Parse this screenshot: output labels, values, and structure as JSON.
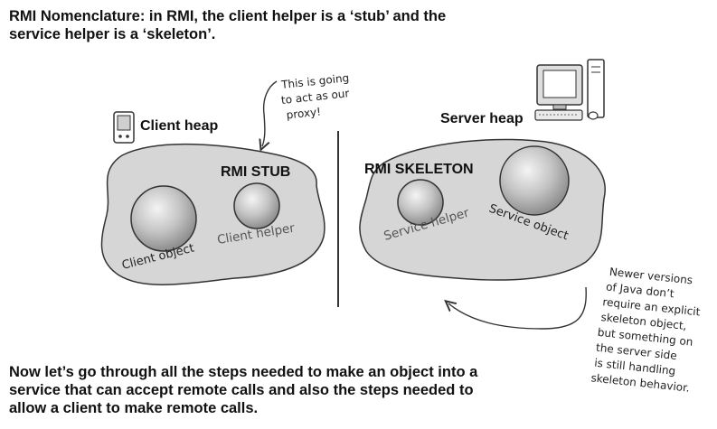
{
  "heading": {
    "line1": "RMI Nomenclature: in RMI, the client helper is a ‘stub’ and the",
    "line2": "service helper is a ‘skeleton’."
  },
  "client_side": {
    "heap_label": "Client heap",
    "stub_label": "RMI STUB",
    "object_label": "Client object",
    "helper_label": "Client helper"
  },
  "server_side": {
    "heap_label": "Server heap",
    "skeleton_label": "RMI SKELETON",
    "helper_label": "Service helper",
    "object_label": "Service object"
  },
  "proxy_note": {
    "lines": [
      "This is going",
      "to act as our",
      "proxy!"
    ]
  },
  "skeleton_note": {
    "lines": [
      "Newer versions",
      "of Java don’t",
      "require an explicit",
      "skeleton object,",
      "but something on",
      "the server side",
      "is still handling",
      "skeleton behavior."
    ]
  },
  "footer": {
    "line1": "Now let’s go through all the steps needed to make an object into a",
    "line2": "service that can accept remote calls and also the steps needed to",
    "line3": "allow a client to make remote calls."
  },
  "icons": {
    "client_device": "pda-icon",
    "server_device": "desktop-computer-icon"
  },
  "colors": {
    "blob_fill": "#d6d6d6",
    "blob_stroke": "#333333",
    "sphere_light": "#f2f2f2",
    "sphere_dark": "#9a9a9a",
    "text": "#111111"
  }
}
